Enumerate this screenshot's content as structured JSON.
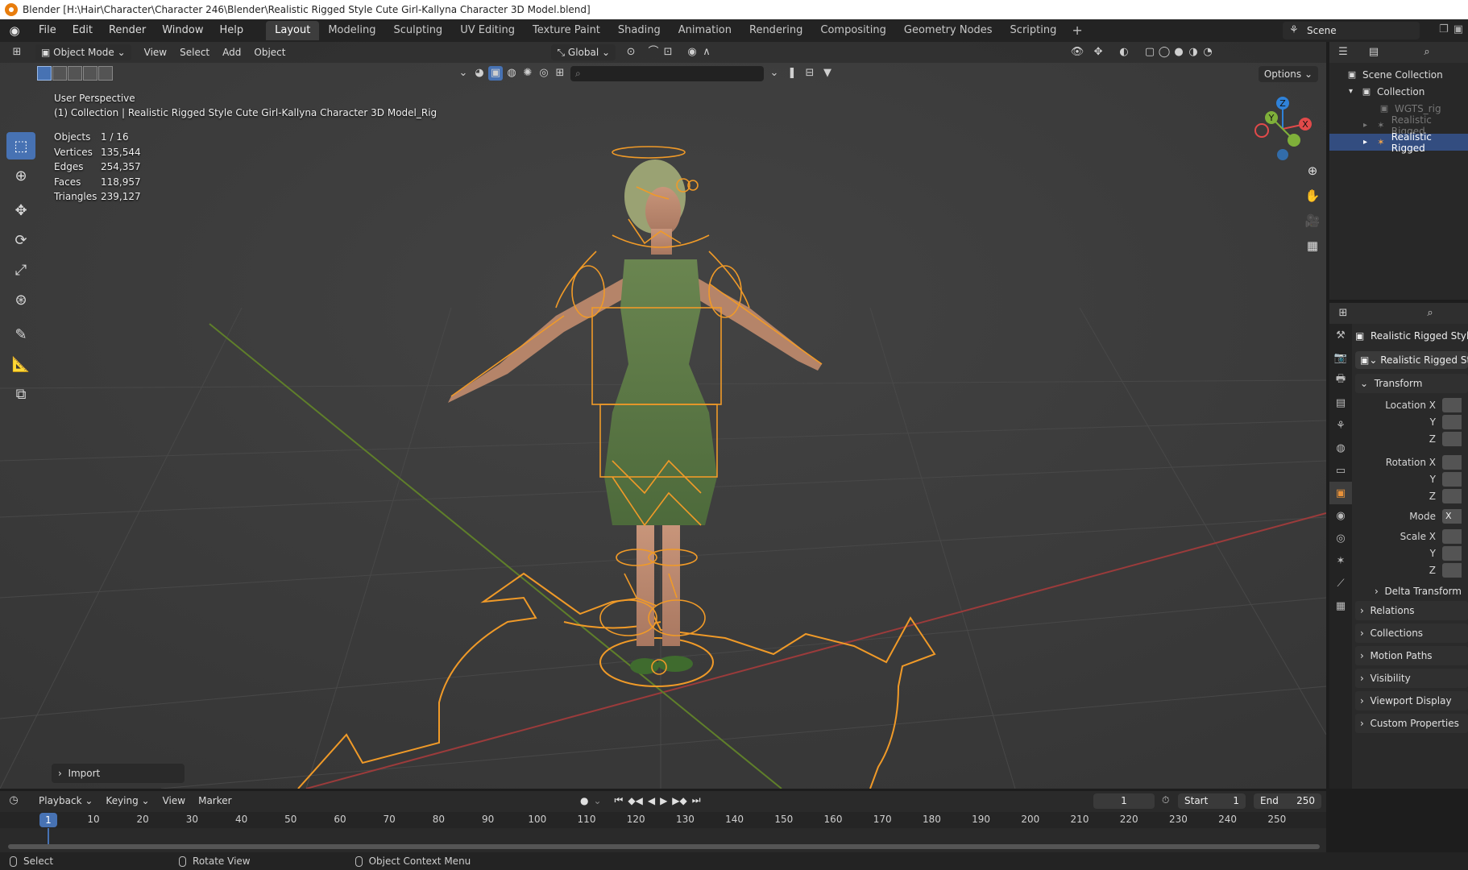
{
  "window": {
    "title": "Blender [H:\\Hair\\Character\\Character 246\\Blender\\Realistic Rigged Style Cute Girl-Kallyna Character 3D Model.blend]"
  },
  "menu": {
    "items": [
      "File",
      "Edit",
      "Render",
      "Window",
      "Help"
    ]
  },
  "workspaces": [
    "Layout",
    "Modeling",
    "Sculpting",
    "UV Editing",
    "Texture Paint",
    "Shading",
    "Animation",
    "Rendering",
    "Compositing",
    "Geometry Nodes",
    "Scripting"
  ],
  "active_workspace": "Layout",
  "scene": {
    "name": "Scene"
  },
  "viewport": {
    "mode": "Object Mode",
    "menus": [
      "View",
      "Select",
      "Add",
      "Object"
    ],
    "orientation": "Global",
    "options_label": "Options",
    "perspective": "User Perspective",
    "collection_info": "(1) Collection | Realistic Rigged Style Cute Girl-Kallyna Character 3D Model_Rig",
    "stats": {
      "objects_label": "Objects",
      "objects": "1 / 16",
      "vertices_label": "Vertices",
      "vertices": "135,544",
      "edges_label": "Edges",
      "edges": "254,357",
      "faces_label": "Faces",
      "faces": "118,957",
      "triangles_label": "Triangles",
      "triangles": "239,127"
    },
    "last_operator": "Import",
    "gizmo_axes": {
      "x": "X",
      "y": "Y",
      "z": "Z"
    },
    "colors": {
      "axis_x": "#e14a4a",
      "axis_y": "#7fb03a",
      "axis_z": "#2f82d9",
      "rig": "#f09a28",
      "dress": "#5e7a45"
    }
  },
  "outliner": {
    "items": [
      {
        "label": "Scene Collection",
        "state": "normal"
      },
      {
        "label": "Collection",
        "state": "normal"
      },
      {
        "label": "WGTS_rig",
        "state": "dim"
      },
      {
        "label": "Realistic Rigged",
        "state": "dim"
      },
      {
        "label": "Realistic Rigged",
        "state": "selected"
      }
    ]
  },
  "properties": {
    "object_name": "Realistic Rigged Styl",
    "data_name": "Realistic Rigged St",
    "sections": {
      "transform": "Transform",
      "location_x": "Location X",
      "y": "Y",
      "z": "Z",
      "rotation_x": "Rotation X",
      "mode": "Mode",
      "mode_value": "X",
      "scale_x": "Scale X",
      "delta_transform": "Delta Transform",
      "relations": "Relations",
      "collections": "Collections",
      "motion_paths": "Motion Paths",
      "visibility": "Visibility",
      "viewport_display": "Viewport Display",
      "custom_properties": "Custom Properties"
    }
  },
  "timeline": {
    "menus": [
      "Playback",
      "Keying",
      "View",
      "Marker"
    ],
    "current_frame": "1",
    "start_label": "Start",
    "start": "1",
    "end_label": "End",
    "end": "250",
    "ticks": [
      "10",
      "20",
      "30",
      "40",
      "50",
      "60",
      "70",
      "80",
      "90",
      "100",
      "110",
      "120",
      "130",
      "140",
      "150",
      "160",
      "170",
      "180",
      "190",
      "200",
      "210",
      "220",
      "230",
      "240",
      "250"
    ]
  },
  "statusbar": {
    "left": "Select",
    "middle": "Rotate View",
    "right": "Object Context Menu"
  }
}
